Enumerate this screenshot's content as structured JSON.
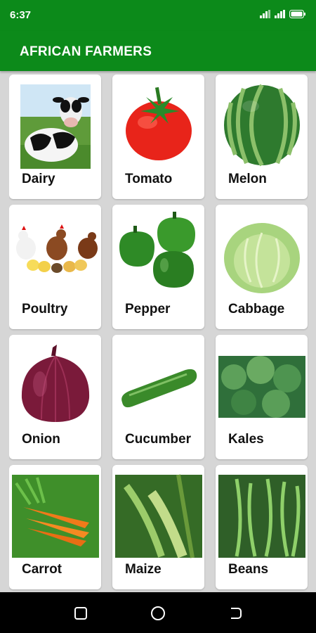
{
  "status": {
    "time": "6:37"
  },
  "app": {
    "title": "AFRICAN FARMERS"
  },
  "items": [
    {
      "label": "Dairy",
      "icon": "cow-image"
    },
    {
      "label": "Tomato",
      "icon": "tomato-image"
    },
    {
      "label": "Melon",
      "icon": "watermelon-image"
    },
    {
      "label": "Poultry",
      "icon": "chickens-image"
    },
    {
      "label": "Pepper",
      "icon": "green-pepper-image"
    },
    {
      "label": "Cabbage",
      "icon": "cabbage-image"
    },
    {
      "label": "Onion",
      "icon": "red-onion-image"
    },
    {
      "label": "Cucumber",
      "icon": "cucumber-image"
    },
    {
      "label": "Kales",
      "icon": "kale-image"
    },
    {
      "label": "Carrot",
      "icon": "carrot-image"
    },
    {
      "label": "Maize",
      "icon": "maize-image"
    },
    {
      "label": "Beans",
      "icon": "green-beans-image"
    }
  ],
  "colors": {
    "app_bar": "#0c8a1a",
    "background": "#d6d6d6",
    "card": "#ffffff",
    "nav_bar": "#000000"
  }
}
